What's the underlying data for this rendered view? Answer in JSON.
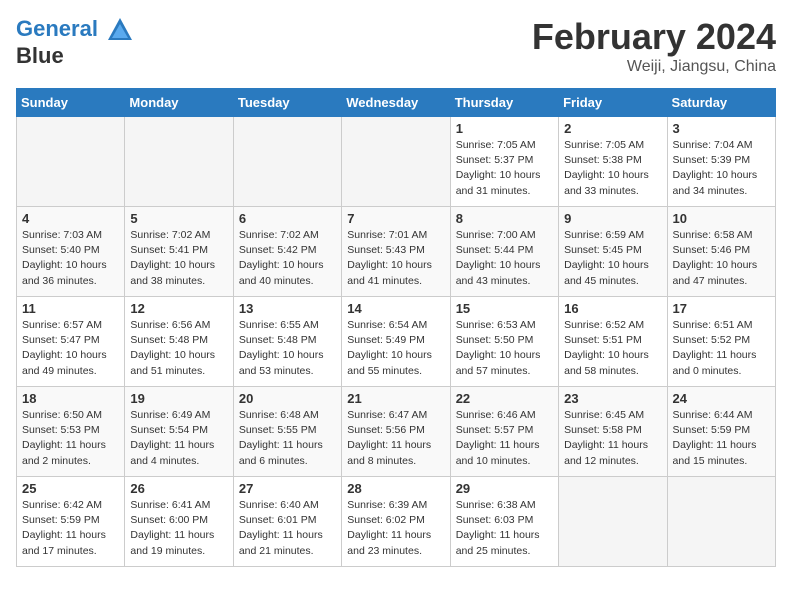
{
  "header": {
    "logo_line1": "General",
    "logo_line2": "Blue",
    "month": "February 2024",
    "location": "Weiji, Jiangsu, China"
  },
  "days_of_week": [
    "Sunday",
    "Monday",
    "Tuesday",
    "Wednesday",
    "Thursday",
    "Friday",
    "Saturday"
  ],
  "weeks": [
    [
      {
        "num": "",
        "empty": true
      },
      {
        "num": "",
        "empty": true
      },
      {
        "num": "",
        "empty": true
      },
      {
        "num": "",
        "empty": true
      },
      {
        "num": "1",
        "sunrise": "7:05 AM",
        "sunset": "5:37 PM",
        "daylight": "10 hours and 31 minutes."
      },
      {
        "num": "2",
        "sunrise": "7:05 AM",
        "sunset": "5:38 PM",
        "daylight": "10 hours and 33 minutes."
      },
      {
        "num": "3",
        "sunrise": "7:04 AM",
        "sunset": "5:39 PM",
        "daylight": "10 hours and 34 minutes."
      }
    ],
    [
      {
        "num": "4",
        "sunrise": "7:03 AM",
        "sunset": "5:40 PM",
        "daylight": "10 hours and 36 minutes."
      },
      {
        "num": "5",
        "sunrise": "7:02 AM",
        "sunset": "5:41 PM",
        "daylight": "10 hours and 38 minutes."
      },
      {
        "num": "6",
        "sunrise": "7:02 AM",
        "sunset": "5:42 PM",
        "daylight": "10 hours and 40 minutes."
      },
      {
        "num": "7",
        "sunrise": "7:01 AM",
        "sunset": "5:43 PM",
        "daylight": "10 hours and 41 minutes."
      },
      {
        "num": "8",
        "sunrise": "7:00 AM",
        "sunset": "5:44 PM",
        "daylight": "10 hours and 43 minutes."
      },
      {
        "num": "9",
        "sunrise": "6:59 AM",
        "sunset": "5:45 PM",
        "daylight": "10 hours and 45 minutes."
      },
      {
        "num": "10",
        "sunrise": "6:58 AM",
        "sunset": "5:46 PM",
        "daylight": "10 hours and 47 minutes."
      }
    ],
    [
      {
        "num": "11",
        "sunrise": "6:57 AM",
        "sunset": "5:47 PM",
        "daylight": "10 hours and 49 minutes."
      },
      {
        "num": "12",
        "sunrise": "6:56 AM",
        "sunset": "5:48 PM",
        "daylight": "10 hours and 51 minutes."
      },
      {
        "num": "13",
        "sunrise": "6:55 AM",
        "sunset": "5:48 PM",
        "daylight": "10 hours and 53 minutes."
      },
      {
        "num": "14",
        "sunrise": "6:54 AM",
        "sunset": "5:49 PM",
        "daylight": "10 hours and 55 minutes."
      },
      {
        "num": "15",
        "sunrise": "6:53 AM",
        "sunset": "5:50 PM",
        "daylight": "10 hours and 57 minutes."
      },
      {
        "num": "16",
        "sunrise": "6:52 AM",
        "sunset": "5:51 PM",
        "daylight": "10 hours and 58 minutes."
      },
      {
        "num": "17",
        "sunrise": "6:51 AM",
        "sunset": "5:52 PM",
        "daylight": "11 hours and 0 minutes."
      }
    ],
    [
      {
        "num": "18",
        "sunrise": "6:50 AM",
        "sunset": "5:53 PM",
        "daylight": "11 hours and 2 minutes."
      },
      {
        "num": "19",
        "sunrise": "6:49 AM",
        "sunset": "5:54 PM",
        "daylight": "11 hours and 4 minutes."
      },
      {
        "num": "20",
        "sunrise": "6:48 AM",
        "sunset": "5:55 PM",
        "daylight": "11 hours and 6 minutes."
      },
      {
        "num": "21",
        "sunrise": "6:47 AM",
        "sunset": "5:56 PM",
        "daylight": "11 hours and 8 minutes."
      },
      {
        "num": "22",
        "sunrise": "6:46 AM",
        "sunset": "5:57 PM",
        "daylight": "11 hours and 10 minutes."
      },
      {
        "num": "23",
        "sunrise": "6:45 AM",
        "sunset": "5:58 PM",
        "daylight": "11 hours and 12 minutes."
      },
      {
        "num": "24",
        "sunrise": "6:44 AM",
        "sunset": "5:59 PM",
        "daylight": "11 hours and 15 minutes."
      }
    ],
    [
      {
        "num": "25",
        "sunrise": "6:42 AM",
        "sunset": "5:59 PM",
        "daylight": "11 hours and 17 minutes."
      },
      {
        "num": "26",
        "sunrise": "6:41 AM",
        "sunset": "6:00 PM",
        "daylight": "11 hours and 19 minutes."
      },
      {
        "num": "27",
        "sunrise": "6:40 AM",
        "sunset": "6:01 PM",
        "daylight": "11 hours and 21 minutes."
      },
      {
        "num": "28",
        "sunrise": "6:39 AM",
        "sunset": "6:02 PM",
        "daylight": "11 hours and 23 minutes."
      },
      {
        "num": "29",
        "sunrise": "6:38 AM",
        "sunset": "6:03 PM",
        "daylight": "11 hours and 25 minutes."
      },
      {
        "num": "",
        "empty": true
      },
      {
        "num": "",
        "empty": true
      }
    ]
  ]
}
